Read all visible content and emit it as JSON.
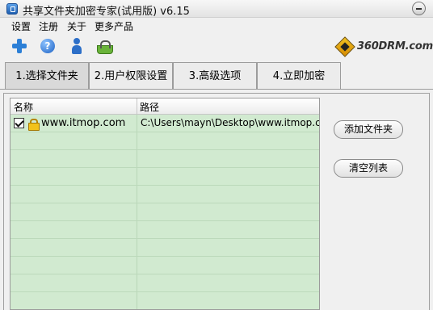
{
  "window": {
    "title": "共享文件夹加密专家(试用版) v6.15"
  },
  "menu": {
    "items": [
      "设置",
      "注册",
      "关于",
      "更多产品"
    ]
  },
  "toolbar": {
    "icons": [
      "add-icon",
      "help-icon",
      "user-icon",
      "shop-icon"
    ],
    "logo_text": "360DRM.com"
  },
  "tabs": [
    {
      "label": "1.选择文件夹",
      "active": true
    },
    {
      "label": "2.用户权限设置",
      "active": false
    },
    {
      "label": "3.高级选项",
      "active": false
    },
    {
      "label": "4.立即加密",
      "active": false
    }
  ],
  "list": {
    "columns": [
      "名称",
      "路径"
    ],
    "rows": [
      {
        "checked": true,
        "locked": true,
        "name": "www.itmop.com",
        "path": "C:\\Users\\mayn\\Desktop\\www.itmop.com"
      }
    ]
  },
  "actions": {
    "add_folder": "添加文件夹",
    "clear_list": "清空列表"
  },
  "colors": {
    "list_background": "#d1ead0"
  }
}
